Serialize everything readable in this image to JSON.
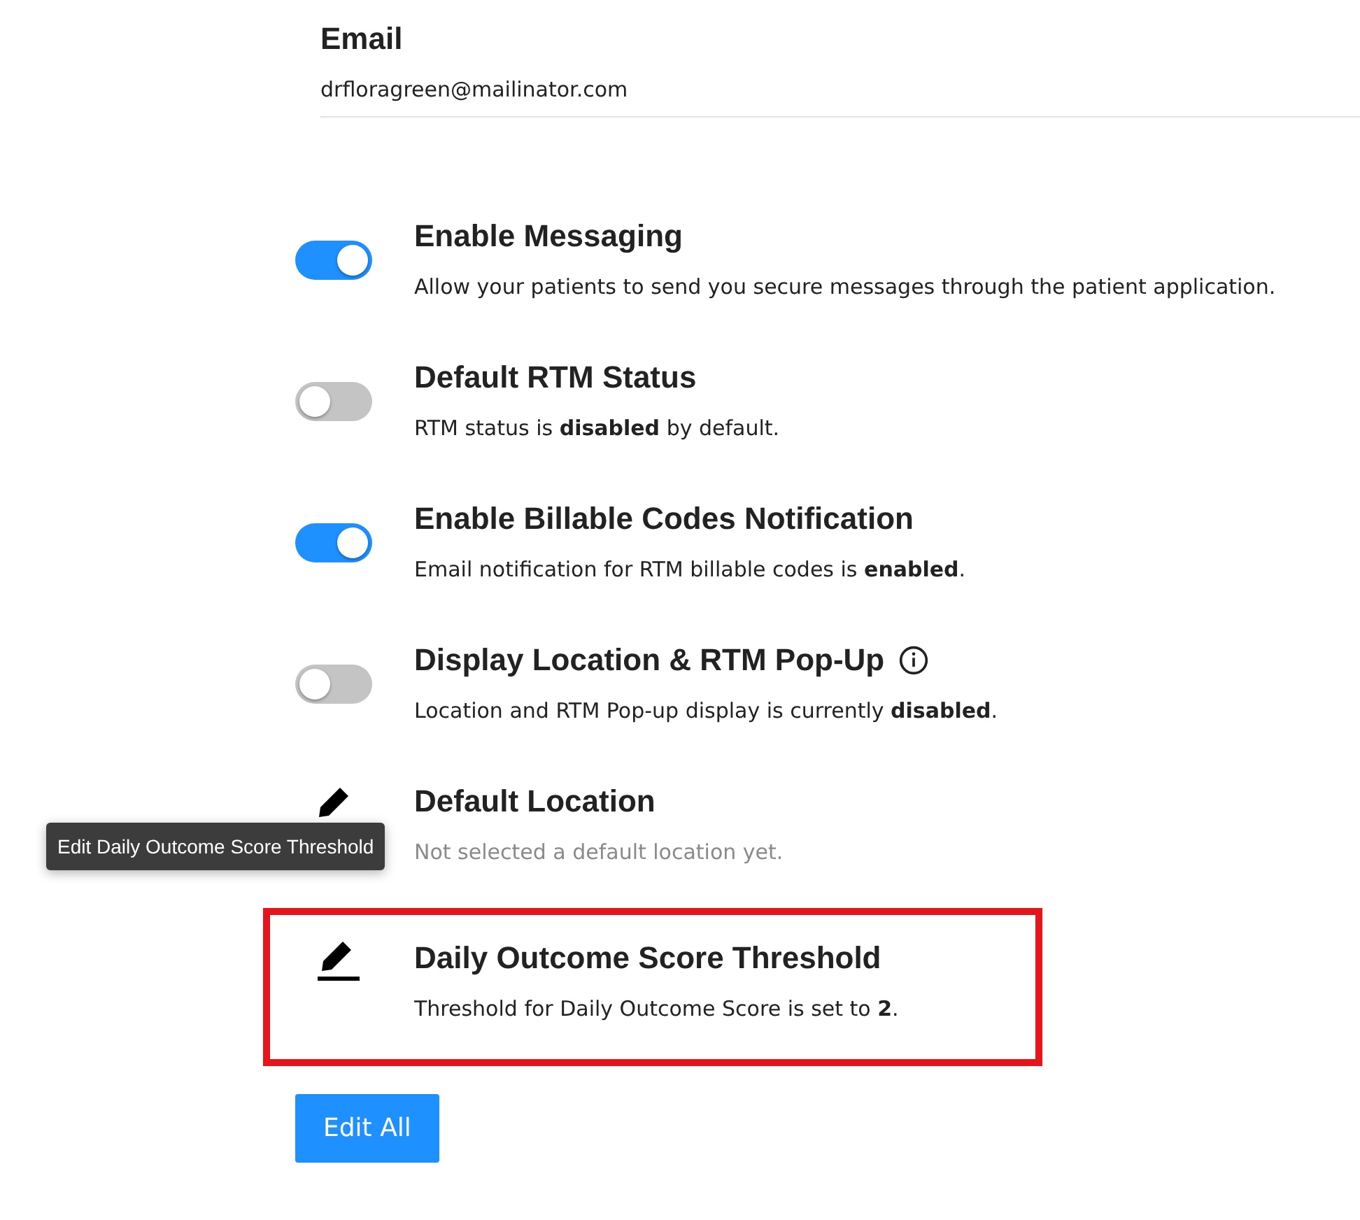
{
  "email": {
    "label": "Email",
    "value": "drfloragreen@mailinator.com"
  },
  "settings": [
    {
      "kind": "toggle",
      "on": true,
      "title": "Enable Messaging",
      "description": "Allow your patients to send you secure messages through the patient application."
    },
    {
      "kind": "toggle",
      "on": false,
      "title": "Default RTM Status",
      "description": "RTM status is **disabled** by default."
    },
    {
      "kind": "toggle",
      "on": true,
      "title": "Enable Billable Codes Notification",
      "description": "Email notification for RTM billable codes is **enabled**."
    },
    {
      "kind": "toggle",
      "on": false,
      "title": "Display Location & RTM Pop-Up",
      "info": true,
      "description": "Location and RTM Pop-up display is currently **disabled**."
    },
    {
      "kind": "edit",
      "title": "Default Location",
      "description": "Not selected a default location yet.",
      "muted": true,
      "tooltip": "Edit Daily Outcome Score Threshold"
    },
    {
      "kind": "edit",
      "title": "Daily Outcome Score Threshold",
      "description": "Threshold for Daily Outcome Score is set to **2**.",
      "highlighted": true
    }
  ],
  "edit_all_button": "Edit All"
}
